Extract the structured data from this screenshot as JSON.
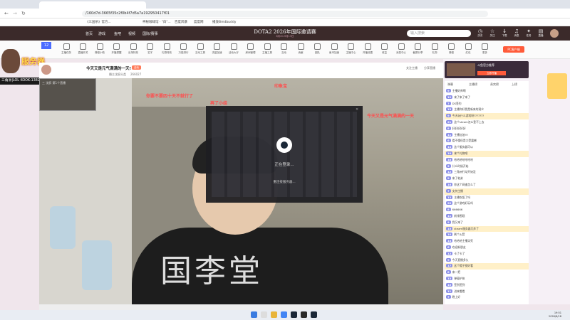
{
  "browser": {
    "tab_title": "",
    "url": "/160d7d-3665f35c2f0b4f7d5a7a192950417f01",
    "bookmarks": [
      "《三国杀》官方...",
      "神秘咖啡馆 · \"白\"...",
      "百度风暴",
      "度度网",
      "播放Bmdbuddy"
    ]
  },
  "site_header": {
    "menu": [
      "首页",
      "游戏",
      "鱼吧",
      "视频",
      "国际/赛事"
    ],
    "title": "DOTA2 2026年国际邀请赛",
    "subtitle": "8月20-9月13日",
    "search_placeholder": "输入搜索",
    "icons": [
      {
        "icon": "clock-icon",
        "label": "历史"
      },
      {
        "icon": "star-icon",
        "label": "关注"
      },
      {
        "icon": "download-icon",
        "label": "下载"
      },
      {
        "icon": "bell-icon",
        "label": "消息"
      },
      {
        "icon": "gift-icon",
        "label": "任务"
      },
      {
        "icon": "chart-icon",
        "label": "直播"
      }
    ]
  },
  "category_bar": {
    "level": "12",
    "items": [
      "主播任务",
      "直播开关",
      "弹幕小助",
      "开播提醒",
      "出场特效",
      "名字",
      "礼物特效",
      "万能排行",
      "互动工具",
      "流量加速",
      "活动大厅",
      "房间管理",
      "主播工具",
      "互动",
      "贡献",
      "团队",
      "鱼币加速",
      "主播中心",
      "开播设置",
      "收益",
      "消息中心",
      "截屏分享",
      "礼物",
      "弹幕",
      "红包",
      "更多"
    ],
    "pc_button": "PC客户端"
  },
  "left_overlay": {
    "logo_text": "服务器",
    "tag_text": "三角洲|LOL KOOK:1382"
  },
  "stream_info": {
    "title": "今天又是元气满满的一天!",
    "badge": "活动",
    "meta": "播主沈醉分类",
    "views": "266027",
    "right_links": [
      "关注主播",
      "分享直播"
    ]
  },
  "video": {
    "cam_label": "三 沈醉 第1个直播",
    "shirt_text": "国李堂",
    "danmu": [
      {
        "text": "你要不要四十天不就行了",
        "color": "#ff3b3b"
      },
      {
        "text": "再了小组",
        "color": "#ff3b3b"
      },
      {
        "text": "印象宝",
        "color": "#ff3b3b"
      },
      {
        "text": "今天又是元气满满的一天",
        "color": "#ff3b3b"
      }
    ]
  },
  "steam_dialog": {
    "status": "正在登录...",
    "sub_status": "重连接服务器..."
  },
  "anchor_card": {
    "name": "斗鱼官方推荐",
    "button": "立即开播"
  },
  "right_tabs": [
    "弹幕",
    "主播榜",
    "贵宾榜",
    "上榜"
  ],
  "chat": [
    {
      "badge": "9",
      "text": "主播好帅啊"
    },
    {
      "badge": "12",
      "text": "来了来了来了"
    },
    {
      "badge": "7",
      "text": "DS签约"
    },
    {
      "badge": "15",
      "text": "主播你好我是新来的观众"
    },
    {
      "badge": "9",
      "text": "今天玩什么游戏呀???????"
    },
    {
      "badge": "21",
      "text": "这个steam怎么登不上去"
    },
    {
      "badge": "8",
      "text": "好好好好好"
    },
    {
      "badge": "11",
      "text": "主播加油!!!"
    },
    {
      "badge": "6",
      "text": "看不懂但是大受震撼"
    },
    {
      "badge": "14",
      "text": "这个服务器可以"
    },
    {
      "badge": "10",
      "text": "来个礼物吧"
    },
    {
      "badge": "18",
      "text": "哈哈哈哈哈哈哈"
    },
    {
      "badge": "5",
      "text": "什么时候开始"
    },
    {
      "badge": "12",
      "text": "三角洲行动开始没"
    },
    {
      "badge": "9",
      "text": "来了老弟"
    },
    {
      "badge": "16",
      "text": "你这个网速怎么了"
    },
    {
      "badge": "7",
      "text": "支持主播"
    },
    {
      "badge": "13",
      "text": "主播吃饭了吗"
    },
    {
      "badge": "20",
      "text": "这个游戏好玩吗"
    },
    {
      "badge": "8",
      "text": "666666"
    },
    {
      "badge": "11",
      "text": "前排围观"
    },
    {
      "badge": "9",
      "text": "我又来了"
    },
    {
      "badge": "15",
      "text": "steam服务器又炸了"
    },
    {
      "badge": "10",
      "text": "刷个火箭"
    },
    {
      "badge": "14",
      "text": "哈哈哈主播笑死"
    },
    {
      "badge": "6",
      "text": "欢迎新朋友"
    },
    {
      "badge": "12",
      "text": "卡了卡了"
    },
    {
      "badge": "9",
      "text": "今天直播多久"
    },
    {
      "badge": "17",
      "text": "这个帽子挺好看"
    },
    {
      "badge": "8",
      "text": "来一把"
    },
    {
      "badge": "13",
      "text": "弹幕护体"
    },
    {
      "badge": "10",
      "text": "签到签到"
    },
    {
      "badge": "11",
      "text": "进来看看"
    },
    {
      "badge": "7",
      "text": "晚上好"
    }
  ],
  "taskbar": {
    "time": "19:51",
    "date": "2026/8/18"
  }
}
